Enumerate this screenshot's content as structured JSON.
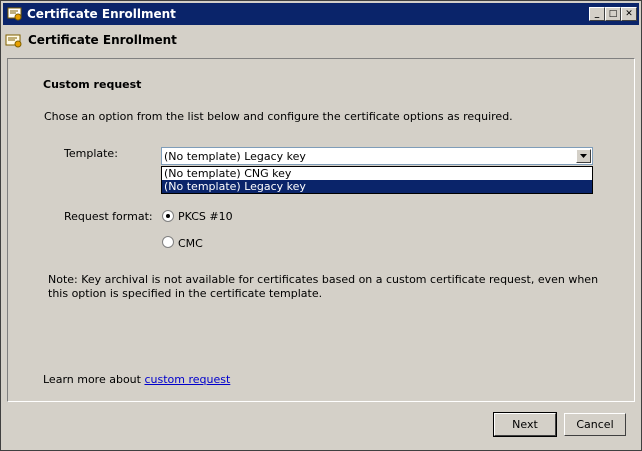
{
  "window": {
    "title": "Certificate Enrollment",
    "controls": {
      "minimize": "_",
      "maximize": "□",
      "close": "✕"
    }
  },
  "header": {
    "title": "Certificate Enrollment"
  },
  "main": {
    "section_title": "Custom request",
    "description": "Chose an option from the list below and configure the certificate options as required.",
    "template": {
      "label": "Template:",
      "selected": "(No template) Legacy key",
      "options": [
        "(No template) CNG key",
        "(No template) Legacy key"
      ],
      "highlighted_index": 1
    },
    "request_format": {
      "label": "Request format:",
      "options": [
        {
          "label": "PKCS #10",
          "checked": true
        },
        {
          "label": "CMC",
          "checked": false
        }
      ]
    },
    "note": "Note: Key archival is not available for certificates based on a custom certificate request, even when this option is specified in the certificate template.",
    "learn_more": {
      "prefix": "Learn more about ",
      "link": "custom request"
    }
  },
  "footer": {
    "next_label": "Next",
    "cancel_label": "Cancel"
  },
  "colors": {
    "titlebar": "#0a246a",
    "face": "#d4d0c8",
    "highlight": "#0a246a",
    "link": "#0000cc"
  }
}
